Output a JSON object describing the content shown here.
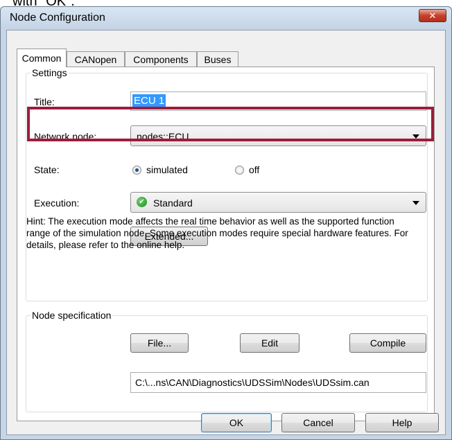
{
  "above_text": "with \"OK\".",
  "window": {
    "title": "Node Configuration",
    "close_glyph": "✕"
  },
  "tabs": [
    {
      "label": "Common",
      "active": true
    },
    {
      "label": "CANopen",
      "active": false
    },
    {
      "label": "Components",
      "active": false
    },
    {
      "label": "Buses",
      "active": false
    }
  ],
  "settings": {
    "group_label": "Settings",
    "title_label": "Title:",
    "title_value": "ECU 1",
    "network_node_label": "Network node:",
    "network_node_value": "nodes::ECU",
    "state_label": "State:",
    "state_options": [
      {
        "label": "simulated",
        "checked": true
      },
      {
        "label": "off",
        "checked": false
      }
    ],
    "execution_label": "Execution:",
    "execution_value": "Standard",
    "extended_button": "Extended...",
    "hint": "Hint: The execution mode affects the real time behavior as well as the supported function range of the simulation node. Some execution modes require special hardware features. For details, please refer to the online help."
  },
  "node_spec": {
    "group_label": "Node specification",
    "file_button": "File...",
    "edit_button": "Edit",
    "compile_button": "Compile",
    "path": "C:\\...ns\\CAN\\Diagnostics\\UDSSim\\Nodes\\UDSsim.can"
  },
  "footer": {
    "ok": "OK",
    "cancel": "Cancel",
    "help": "Help"
  },
  "colors": {
    "highlight": "#9e1c3a",
    "selection": "#3399ff",
    "window_frame": "#c7d6e6"
  }
}
